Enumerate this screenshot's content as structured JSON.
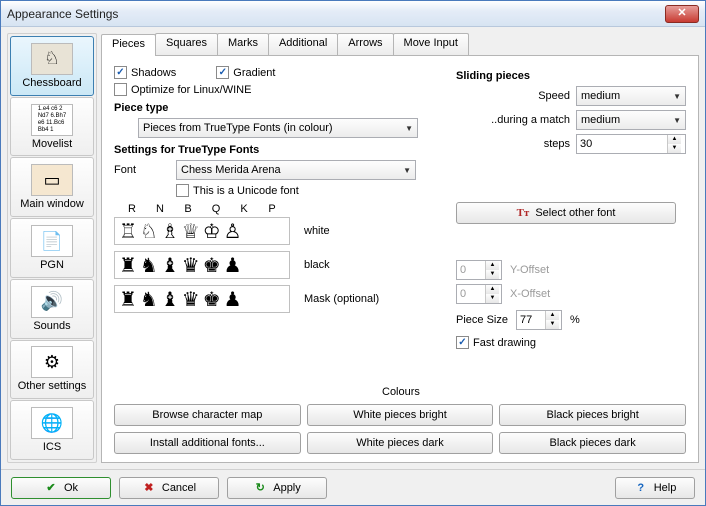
{
  "window": {
    "title": "Appearance Settings"
  },
  "sidebar": {
    "items": [
      "Chessboard",
      "Movelist",
      "Main window",
      "PGN",
      "Sounds",
      "Other settings",
      "ICS"
    ]
  },
  "tabs": [
    "Pieces",
    "Squares",
    "Marks",
    "Additional",
    "Arrows",
    "Move Input"
  ],
  "pieces": {
    "shadows": "Shadows",
    "gradient": "Gradient",
    "optimize": "Optimize for Linux/WINE",
    "piece_type_label": "Piece type",
    "piece_type_value": "Pieces from TrueType Fonts (in colour)",
    "ttf_settings_label": "Settings for TrueType Fonts",
    "font_label": "Font",
    "font_value": "Chess Merida Arena",
    "unicode_label": "This is a Unicode font",
    "cols": [
      "R",
      "N",
      "B",
      "Q",
      "K",
      "P"
    ],
    "row_white": "white",
    "row_black": "black",
    "row_mask": "Mask (optional)",
    "select_other_font": "Select other font"
  },
  "sliding": {
    "title": "Sliding pieces",
    "speed_label": "Speed",
    "speed_value": "medium",
    "during_label": "..during a match",
    "during_value": "medium",
    "steps_label": "steps",
    "steps_value": "30"
  },
  "offsets": {
    "y": "0",
    "y_label": "Y-Offset",
    "x": "0",
    "x_label": "X-Offset",
    "size_label": "Piece Size",
    "size": "77",
    "percent": "%",
    "fast_drawing": "Fast drawing"
  },
  "colours": {
    "label": "Colours",
    "browse": "Browse character map",
    "install_fonts": "Install additional fonts...",
    "white_bright": "White pieces bright",
    "white_dark": "White pieces dark",
    "black_bright": "Black pieces bright",
    "black_dark": "Black pieces dark"
  },
  "footer": {
    "ok": "Ok",
    "cancel": "Cancel",
    "apply": "Apply",
    "help": "Help"
  }
}
